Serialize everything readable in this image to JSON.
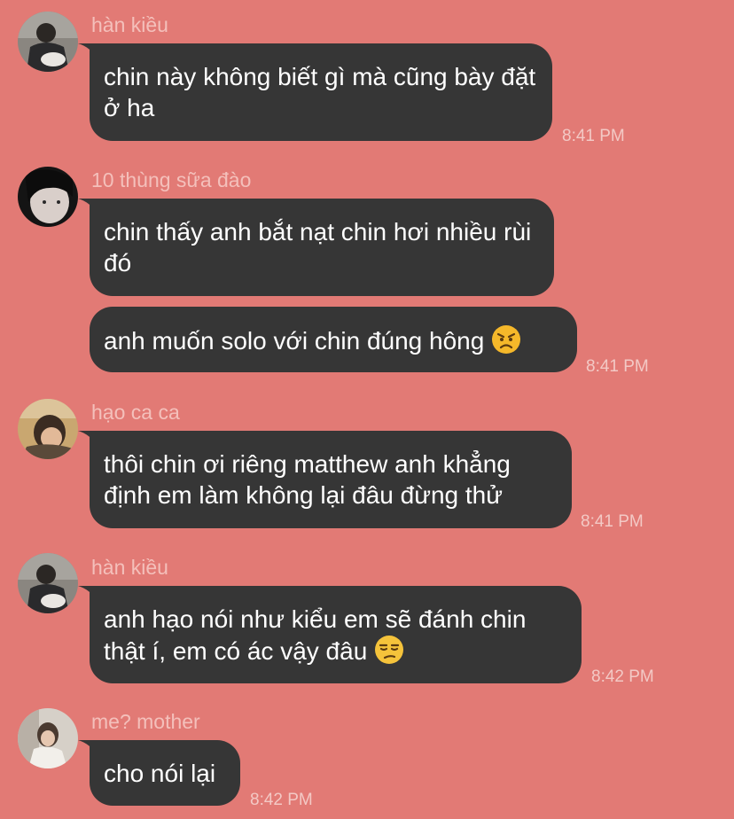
{
  "messages": [
    {
      "sender": "hàn kiều",
      "bubbles": [
        {
          "text": "chin này không biết gì mà cũng bày đặt ở ha",
          "time": "8:41 PM"
        }
      ]
    },
    {
      "sender": "10 thùng sữa đào",
      "bubbles": [
        {
          "text": "chin thấy anh bắt nạt chin hơi nhiều rùi đó",
          "time": ""
        },
        {
          "text": "anh muốn solo với chin đúng hông",
          "time": "8:41 PM",
          "emoji": "angry-face"
        }
      ]
    },
    {
      "sender": "hạo ca ca",
      "bubbles": [
        {
          "text": "thôi chin ơi riêng matthew anh khẳng định em làm không lại đâu đừng thử",
          "time": "8:41 PM"
        }
      ]
    },
    {
      "sender": "hàn kiều",
      "bubbles": [
        {
          "text": "anh hạo nói như kiểu em sẽ đánh chin thật í, em có ác vậy đâu",
          "time": "8:42 PM",
          "emoji": "unamused-face"
        }
      ]
    },
    {
      "sender": "me? mother",
      "bubbles": [
        {
          "text": "cho nói lại",
          "time": "8:42 PM"
        }
      ]
    }
  ],
  "colors": {
    "background": "#e27a75",
    "bubble": "#363636",
    "bubble_text": "#ffffff",
    "sender_text": "#f4c0bb",
    "time_text": "#f3c9c5"
  }
}
